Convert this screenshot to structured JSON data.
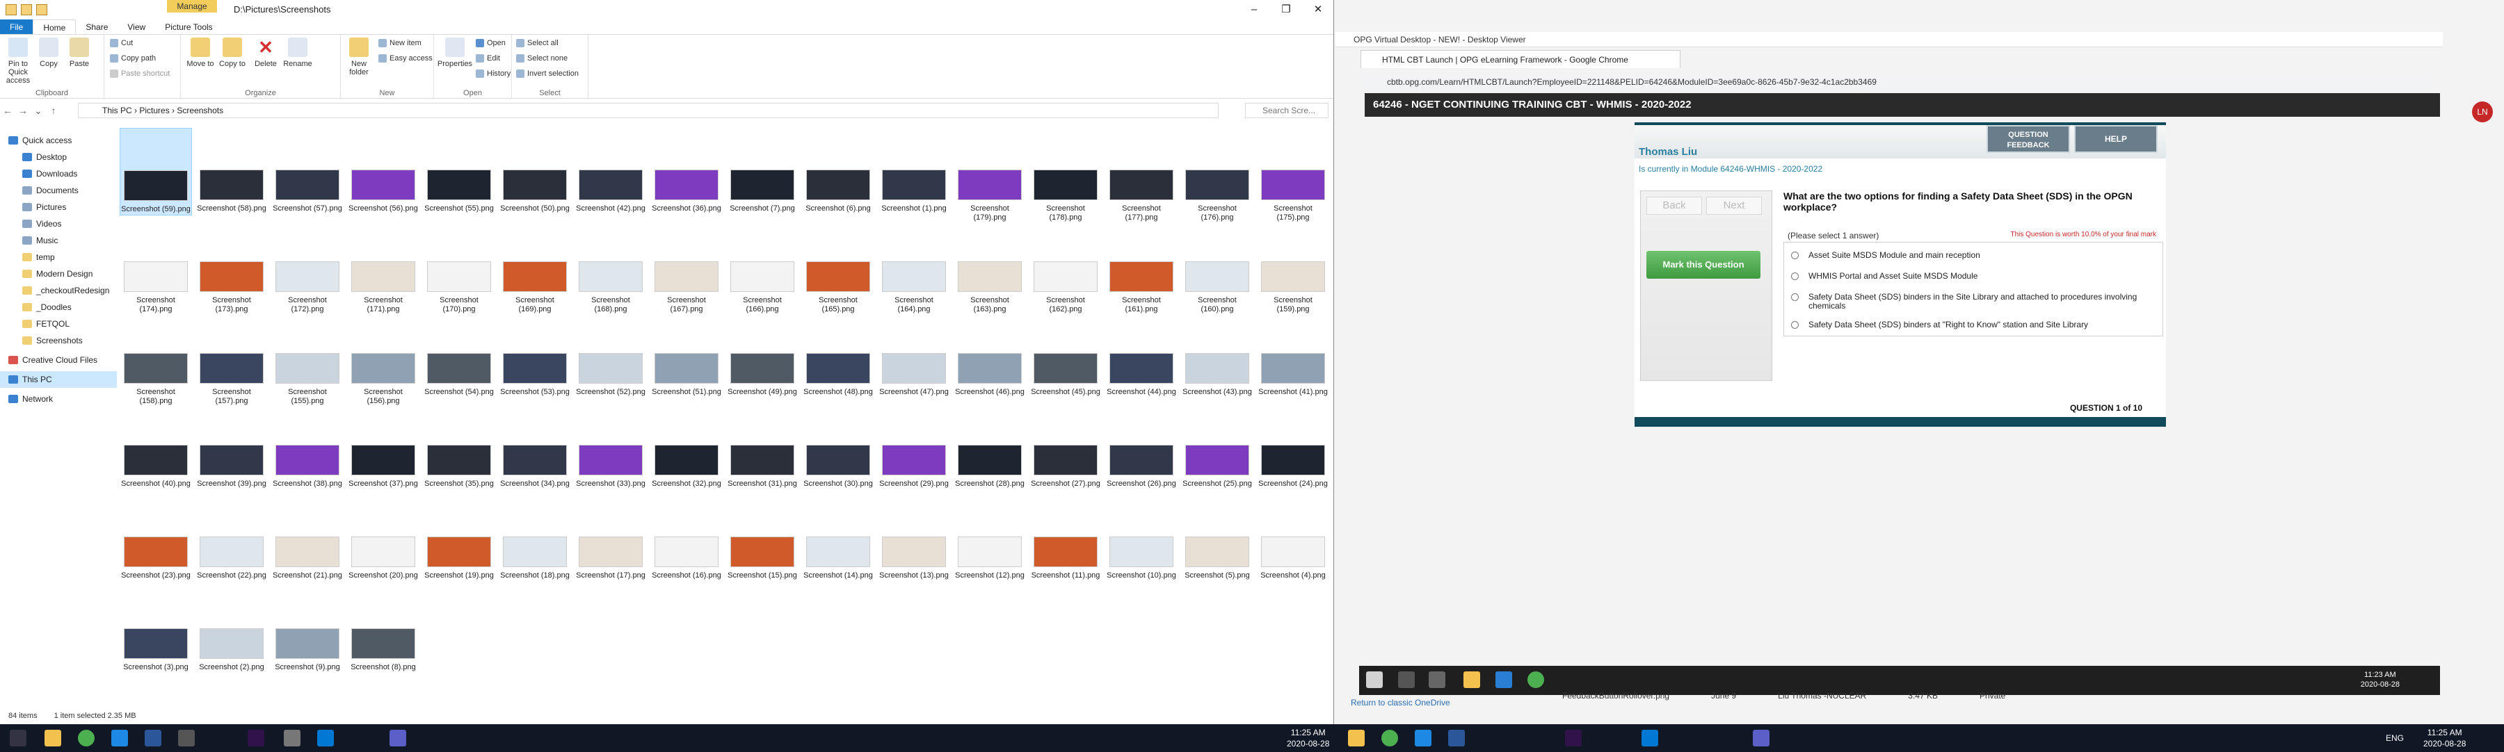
{
  "explorer": {
    "manage_tab": "Manage",
    "title_path": "D:\\Pictures\\Screenshots",
    "tabs": [
      "File",
      "Home",
      "Share",
      "View",
      "Picture Tools"
    ],
    "ribbon": {
      "pin_label": "Pin to Quick access",
      "copy": "Copy",
      "paste": "Paste",
      "cut": "Cut",
      "copy_path": "Copy path",
      "paste_shortcut": "Paste shortcut",
      "move_to": "Move to",
      "copy_to": "Copy to",
      "delete": "Delete",
      "rename": "Rename",
      "new_folder": "New folder",
      "new_item": "New item",
      "easy_access": "Easy access",
      "properties": "Properties",
      "open": "Open",
      "edit": "Edit",
      "history": "History",
      "select_all": "Select all",
      "select_none": "Select none",
      "invert_selection": "Invert selection",
      "groups": [
        "Clipboard",
        "Organize",
        "New",
        "Open",
        "Select"
      ]
    },
    "breadcrumb": [
      "This PC",
      "Pictures",
      "Screenshots"
    ],
    "search_placeholder": "Search Scre...",
    "nav_items": [
      "Quick access",
      "Desktop",
      "Downloads",
      "Documents",
      "Pictures",
      "Videos",
      "Music",
      "temp",
      "Modern Design",
      "_checkoutRedesign",
      "_Doodles",
      "FETQOL",
      "Screenshots",
      "Creative Cloud Files",
      "This PC",
      "Network"
    ],
    "files_rows": [
      [
        "Screenshot (59).png",
        "Screenshot (58).png",
        "Screenshot (57).png",
        "Screenshot (56).png",
        "Screenshot (55).png",
        "Screenshot (50).png",
        "Screenshot (42).png",
        "Screenshot (36).png",
        "Screenshot (7).png",
        "Screenshot (6).png",
        "Screenshot (1).png",
        "Screenshot (179).png",
        "Screenshot (178).png",
        "Screenshot (177).png",
        "Screenshot (176).png",
        "Screenshot (175).png"
      ],
      [
        "Screenshot (174).png",
        "Screenshot (173).png",
        "Screenshot (172).png",
        "Screenshot (171).png",
        "Screenshot (170).png",
        "Screenshot (169).png",
        "Screenshot (168).png",
        "Screenshot (167).png",
        "Screenshot (166).png",
        "Screenshot (165).png",
        "Screenshot (164).png",
        "Screenshot (163).png",
        "Screenshot (162).png",
        "Screenshot (161).png",
        "Screenshot (160).png",
        "Screenshot (159).png"
      ],
      [
        "Screenshot (158).png",
        "Screenshot (157).png",
        "Screenshot (155).png",
        "Screenshot (156).png",
        "Screenshot (54).png",
        "Screenshot (53).png",
        "Screenshot (52).png",
        "Screenshot (51).png",
        "Screenshot (49).png",
        "Screenshot (48).png",
        "Screenshot (47).png",
        "Screenshot (46).png",
        "Screenshot (45).png",
        "Screenshot (44).png",
        "Screenshot (43).png",
        "Screenshot (41).png"
      ],
      [
        "Screenshot (40).png",
        "Screenshot (39).png",
        "Screenshot (38).png",
        "Screenshot (37).png",
        "Screenshot (35).png",
        "Screenshot (34).png",
        "Screenshot (33).png",
        "Screenshot (32).png",
        "Screenshot (31).png",
        "Screenshot (30).png",
        "Screenshot (29).png",
        "Screenshot (28).png",
        "Screenshot (27).png",
        "Screenshot (26).png",
        "Screenshot (25).png",
        "Screenshot (24).png"
      ],
      [
        "Screenshot (23).png",
        "Screenshot (22).png",
        "Screenshot (21).png",
        "Screenshot (20).png",
        "Screenshot (19).png",
        "Screenshot (18).png",
        "Screenshot (17).png",
        "Screenshot (16).png",
        "Screenshot (15).png",
        "Screenshot (14).png",
        "Screenshot (13).png",
        "Screenshot (12).png",
        "Screenshot (11).png",
        "Screenshot (10).png",
        "Screenshot (5).png",
        "Screenshot (4).png"
      ],
      [
        "Screenshot (3).png",
        "Screenshot (2).png",
        "Screenshot (9).png",
        "Screenshot (8).png"
      ]
    ],
    "status_count": "84 items",
    "status_selected": "1 item selected  2.35 MB"
  },
  "viewer": {
    "window_title": "OPG Virtual Desktop - NEW! - Desktop Viewer",
    "chrome_tab": "HTML CBT Launch | OPG eLearning Framework - Google Chrome",
    "url": "cbtb.opg.com/Learn/HTMLCBT/Launch?EmployeeID=221148&PELID=64246&ModuleID=3ee69a0c-8626-45b7-9e32-4c1ac2bb3469",
    "page_header": "64246 - NGET CONTINUING TRAINING CBT - WHMIS - 2020-2022",
    "avatar_initials": "LN",
    "cbt": {
      "learner": "Thomas Liu",
      "module": "Is currently in Module 64246-WHMIS - 2020-2022",
      "feedback_button": "QUESTION FEEDBACK",
      "help_button": "HELP",
      "back": "Back",
      "next": "Next",
      "mark_question": "Mark this Question",
      "question": "What are the two options for finding a Safety Data Sheet (SDS) in the OPGN workplace?",
      "instruction": "(Please select 1 answer)",
      "worth": "This Question is worth 10.0% of your final mark",
      "options": [
        "Asset Suite MSDS Module and main reception",
        "WHMIS Portal and Asset Suite MSDS Module",
        "Safety Data Sheet (SDS) binders in the Site Library and attached to procedures involving chemicals",
        "Safety Data Sheet (SDS) binders at \"Right to Know\" station and Site Library"
      ],
      "counter": "QUESTION 1 of 10"
    },
    "vd_time": "11:23 AM",
    "vd_date": "2020-08-28",
    "onedrive_link": "Return to classic OneDrive",
    "behind_row": [
      "FeedbackButtonRollover.png",
      "June 9",
      "Liu Thomas -NUCLEAR",
      "3.47 KB",
      "Private"
    ]
  },
  "taskbar": {
    "left_time": "11:25 AM",
    "left_date": "2020-08-28",
    "lang": "ENG",
    "right_time": "11:25 AM",
    "right_date": "2020-08-28"
  }
}
